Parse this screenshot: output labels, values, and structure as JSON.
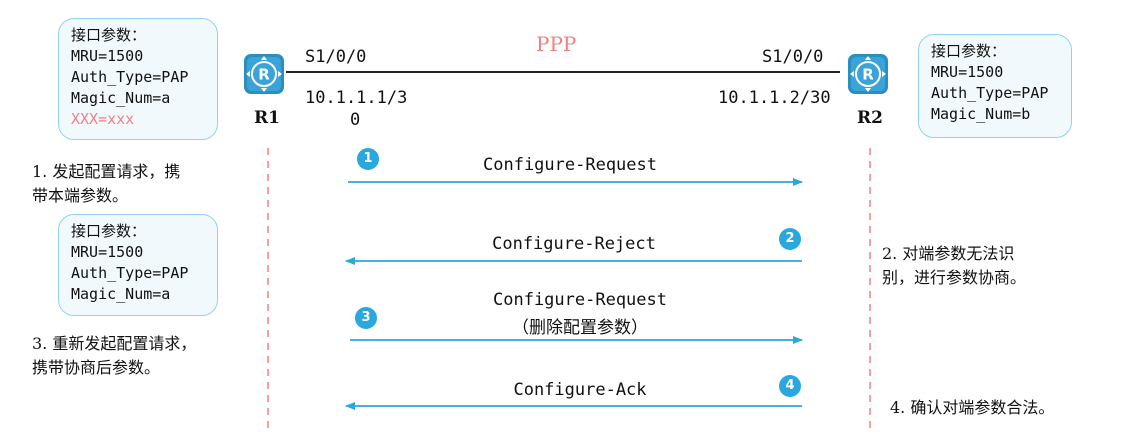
{
  "protocol_label": "PPP",
  "colors": {
    "accent": "#29a8e0",
    "highlight": "#f08080",
    "protocol": "#f08080",
    "box_border": "#8fd3f0",
    "dashed_line": "#f08080"
  },
  "routers": {
    "r1": {
      "name": "R1",
      "interface": "S1/0/0",
      "ip_line1": "10.1.1.1/3",
      "ip_line2": "0",
      "icon": "router-icon"
    },
    "r2": {
      "name": "R2",
      "interface": "S1/0/0",
      "ip": "10.1.1.2/30",
      "icon": "router-icon"
    }
  },
  "param_boxes": {
    "r1_initial": [
      "接口参数：",
      "MRU=1500",
      "Auth_Type=PAP",
      "Magic_Num=a",
      "XXX=xxx"
    ],
    "r1_revised": [
      "接口参数：",
      "MRU=1500",
      "Auth_Type=PAP",
      "Magic_Num=a"
    ],
    "r2": [
      "接口参数：",
      "MRU=1500",
      "Auth_Type=PAP",
      "Magic_Num=b"
    ]
  },
  "notes": {
    "step1": [
      "1. 发起配置请求，携",
      "带本端参数。"
    ],
    "step2": [
      "2. 对端参数无法识",
      "别，进行参数协商。"
    ],
    "step3": [
      "3. 重新发起配置请求，",
      "携带协商后参数。"
    ],
    "step4": [
      "4. 确认对端参数合法。"
    ]
  },
  "messages": [
    {
      "step": "1",
      "label": "Configure-Request",
      "sublabel": "",
      "direction": "right"
    },
    {
      "step": "2",
      "label": "Configure-Reject",
      "sublabel": "",
      "direction": "left"
    },
    {
      "step": "3",
      "label": "Configure-Request",
      "sublabel": "（删除配置参数）",
      "direction": "right"
    },
    {
      "step": "4",
      "label": "Configure-Ack",
      "sublabel": "",
      "direction": "left"
    }
  ]
}
